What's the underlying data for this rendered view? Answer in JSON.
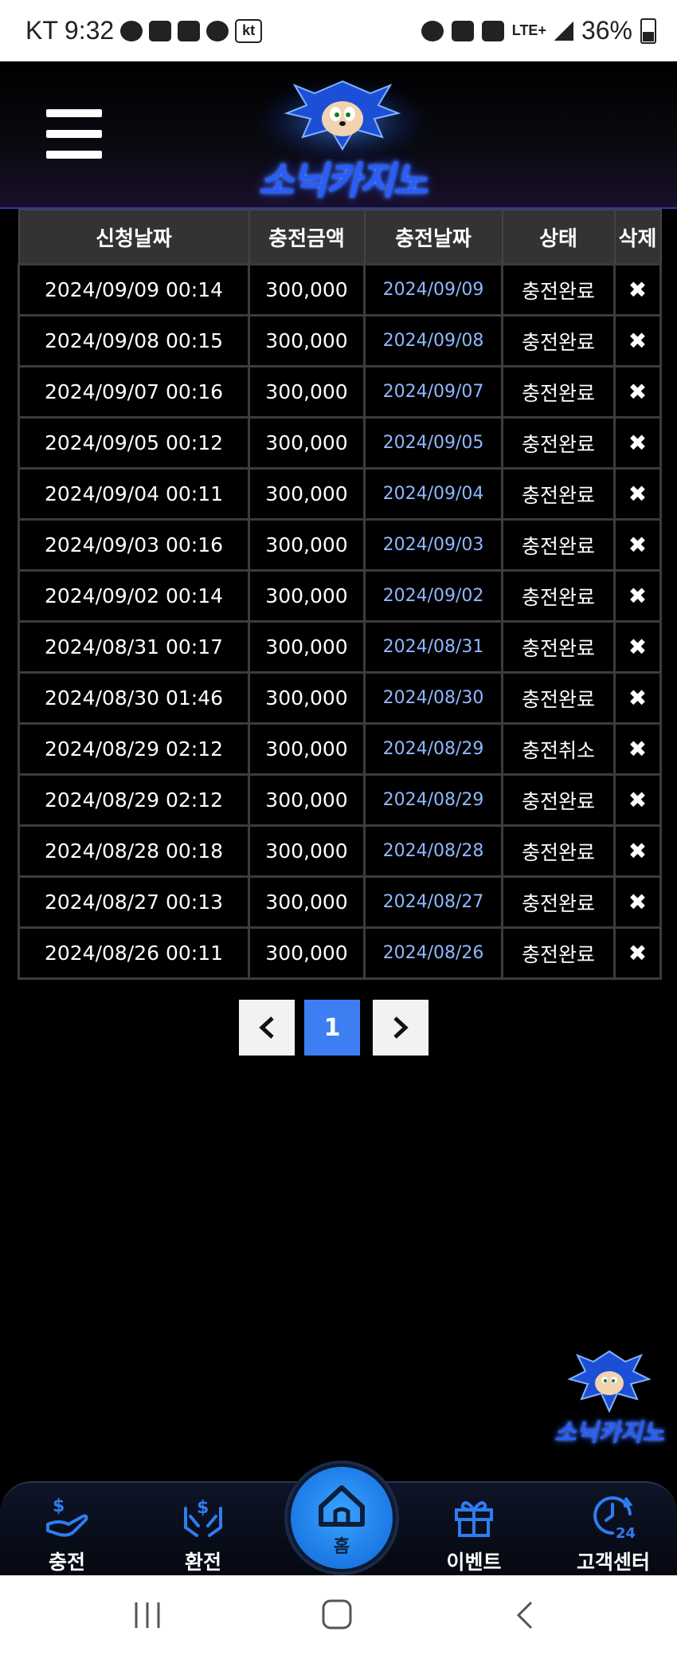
{
  "status_bar": {
    "carrier": "KT",
    "time": "9:32",
    "battery": "36%",
    "network": "LTE+"
  },
  "header": {
    "brand": "소닉카지노"
  },
  "table": {
    "headers": [
      "신청날짜",
      "충전금액",
      "충전날짜",
      "상태",
      "삭제"
    ],
    "rows": [
      {
        "requested": "2024/09/09 00:14",
        "amount": "300,000",
        "charged": "2024/09/09",
        "status": "충전완료",
        "delete": "✖"
      },
      {
        "requested": "2024/09/08 00:15",
        "amount": "300,000",
        "charged": "2024/09/08",
        "status": "충전완료",
        "delete": "✖"
      },
      {
        "requested": "2024/09/07 00:16",
        "amount": "300,000",
        "charged": "2024/09/07",
        "status": "충전완료",
        "delete": "✖"
      },
      {
        "requested": "2024/09/05 00:12",
        "amount": "300,000",
        "charged": "2024/09/05",
        "status": "충전완료",
        "delete": "✖"
      },
      {
        "requested": "2024/09/04 00:11",
        "amount": "300,000",
        "charged": "2024/09/04",
        "status": "충전완료",
        "delete": "✖"
      },
      {
        "requested": "2024/09/03 00:16",
        "amount": "300,000",
        "charged": "2024/09/03",
        "status": "충전완료",
        "delete": "✖"
      },
      {
        "requested": "2024/09/02 00:14",
        "amount": "300,000",
        "charged": "2024/09/02",
        "status": "충전완료",
        "delete": "✖"
      },
      {
        "requested": "2024/08/31 00:17",
        "amount": "300,000",
        "charged": "2024/08/31",
        "status": "충전완료",
        "delete": "✖"
      },
      {
        "requested": "2024/08/30 01:46",
        "amount": "300,000",
        "charged": "2024/08/30",
        "status": "충전완료",
        "delete": "✖"
      },
      {
        "requested": "2024/08/29 02:12",
        "amount": "300,000",
        "charged": "2024/08/29",
        "status": "충전취소",
        "delete": "✖"
      },
      {
        "requested": "2024/08/29 02:12",
        "amount": "300,000",
        "charged": "2024/08/29",
        "status": "충전완료",
        "delete": "✖"
      },
      {
        "requested": "2024/08/28 00:18",
        "amount": "300,000",
        "charged": "2024/08/28",
        "status": "충전완료",
        "delete": "✖"
      },
      {
        "requested": "2024/08/27 00:13",
        "amount": "300,000",
        "charged": "2024/08/27",
        "status": "충전완료",
        "delete": "✖"
      },
      {
        "requested": "2024/08/26 00:11",
        "amount": "300,000",
        "charged": "2024/08/26",
        "status": "충전완료",
        "delete": "✖"
      }
    ]
  },
  "pagination": {
    "prev": "‹",
    "current": "1",
    "next": "›"
  },
  "floating": {
    "brand": "소닉카지노"
  },
  "bottom_nav": {
    "deposit": "충전",
    "withdraw": "환전",
    "home": "홈",
    "event": "이벤트",
    "support": "고객센터"
  },
  "colors": {
    "accent_blue": "#3d7ff2",
    "nav_icon_blue": "#2f7df0",
    "charged_date": "#8fb7ff"
  }
}
